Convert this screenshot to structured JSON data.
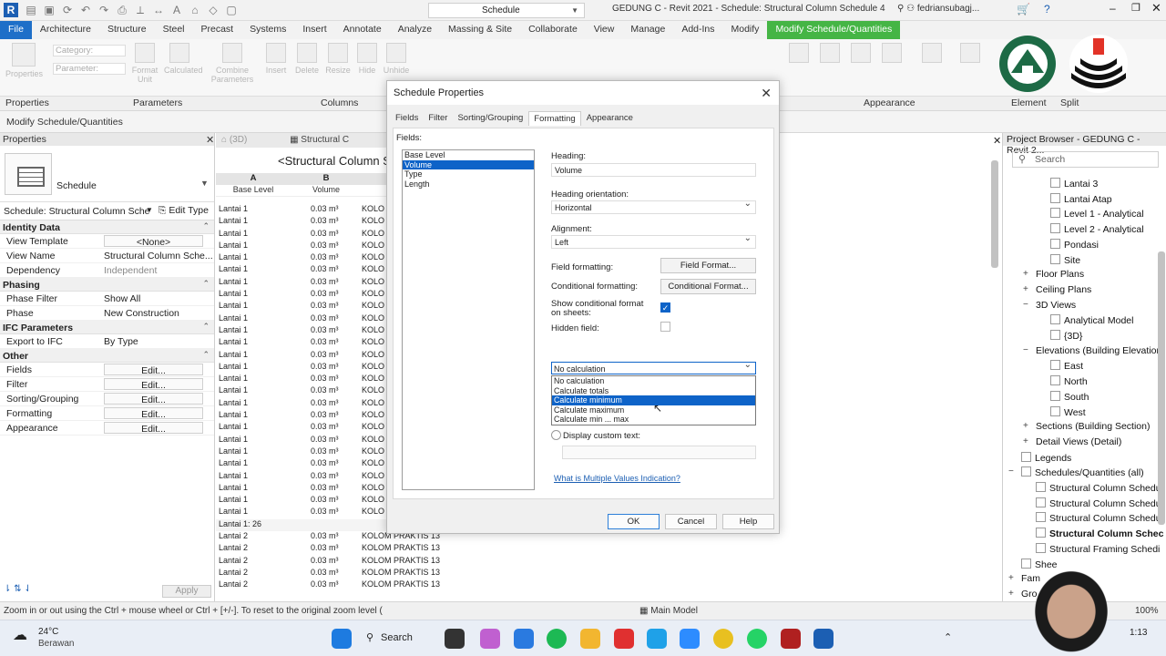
{
  "app": {
    "view_selector": "Schedule",
    "window_title": "GEDUNG C - Revit 2021 - Schedule: Structural Column Schedule 4",
    "user": "fedriansubagj...",
    "tabs": [
      "File",
      "Architecture",
      "Structure",
      "Steel",
      "Precast",
      "Systems",
      "Insert",
      "Annotate",
      "Analyze",
      "Massing & Site",
      "Collaborate",
      "View",
      "Manage",
      "Add-Ins",
      "Modify",
      "Modify Schedule/Quantities"
    ],
    "ribbon_groups": [
      "Properties",
      "Parameters",
      "Columns",
      "Appearance",
      "Element",
      "Split"
    ],
    "ribbon_tools": {
      "properties": "Properties",
      "category": "Category:",
      "parameter": "Parameter:",
      "format_unit": "Format\nUnit",
      "calculated": "Calculated",
      "combine_parameters": "Combine\nParameters",
      "insert": "Insert",
      "delete": "Delete",
      "resize": "Resize",
      "hide": "Hide",
      "unhide": "Unhide"
    },
    "context_bar": "Modify Schedule/Quantities"
  },
  "properties": {
    "title": "Properties",
    "type_name": "Schedule",
    "selector": "Schedule: Structural Column Sche",
    "edit_type": "Edit Type",
    "sections": [
      {
        "name": "Identity Data",
        "rows": [
          {
            "k": "View Template",
            "v": "<None>",
            "btn": true
          },
          {
            "k": "View Name",
            "v": "Structural Column Sche..."
          },
          {
            "k": "Dependency",
            "v": "Independent",
            "grey": true
          }
        ]
      },
      {
        "name": "Phasing",
        "rows": [
          {
            "k": "Phase Filter",
            "v": "Show All"
          },
          {
            "k": "Phase",
            "v": "New Construction"
          }
        ]
      },
      {
        "name": "IFC Parameters",
        "rows": [
          {
            "k": "Export to IFC",
            "v": "By Type"
          }
        ]
      },
      {
        "name": "Other",
        "rows": [
          {
            "k": "Fields",
            "v": "Edit...",
            "btn": true
          },
          {
            "k": "Filter",
            "v": "Edit...",
            "btn": true
          },
          {
            "k": "Sorting/Grouping",
            "v": "Edit...",
            "btn": true
          },
          {
            "k": "Formatting",
            "v": "Edit...",
            "btn": true
          },
          {
            "k": "Appearance",
            "v": "Edit...",
            "btn": true
          }
        ]
      }
    ],
    "apply": "Apply"
  },
  "schedule": {
    "tab_3d": "(3D)",
    "tab_sched": "Structural C",
    "title": "<Structural Column S",
    "col_letters": [
      "A",
      "B"
    ],
    "col_names": [
      "Base Level",
      "Volume"
    ],
    "rows_lantai1": {
      "level": "Lantai 1",
      "volume": "0.03 m³",
      "mark": "KOLO"
    },
    "lantai1_count": 26,
    "group_footer": "Lantai 1: 26",
    "rows_lantai2": {
      "level": "Lantai 2",
      "volume": "0.03 m³",
      "mark": "KOLOM PRAKTIS 13"
    }
  },
  "dialog": {
    "title": "Schedule Properties",
    "tabs": [
      "Fields",
      "Filter",
      "Sorting/Grouping",
      "Formatting",
      "Appearance"
    ],
    "active_tab": "Formatting",
    "fields_label": "Fields:",
    "fields": [
      "Base Level",
      "Volume",
      "Type",
      "Length"
    ],
    "selected_field": "Volume",
    "heading_label": "Heading:",
    "heading_value": "Volume",
    "orientation_label": "Heading orientation:",
    "orientation_value": "Horizontal",
    "alignment_label": "Alignment:",
    "alignment_value": "Left",
    "field_formatting_label": "Field formatting:",
    "field_format_button": "Field Format...",
    "conditional_label": "Conditional formatting:",
    "conditional_button": "Conditional Format...",
    "show_cond_label": "Show conditional format on sheets:",
    "hidden_field_label": "Hidden field:",
    "calc_value": "No calculation",
    "calc_options": [
      "No calculation",
      "Calculate totals",
      "Calculate minimum",
      "Calculate maximum",
      "Calculate min ... max"
    ],
    "calc_highlight": "Calculate minimum",
    "custom_text_label": "Display custom text:",
    "mvi_link": "What is Multiple Values Indication?",
    "ok": "OK",
    "cancel": "Cancel",
    "help": "Help"
  },
  "project_browser": {
    "title": "Project Browser - GEDUNG C - Revit 2...",
    "search_placeholder": "Search",
    "items": [
      {
        "t": "Lantai 3",
        "lvl": 2,
        "icon": true
      },
      {
        "t": "Lantai Atap",
        "lvl": 2,
        "icon": true
      },
      {
        "t": "Level 1 - Analytical",
        "lvl": 2,
        "icon": true
      },
      {
        "t": "Level 2 - Analytical",
        "lvl": 2,
        "icon": true
      },
      {
        "t": "Pondasi",
        "lvl": 2,
        "icon": true
      },
      {
        "t": "Site",
        "lvl": 2,
        "icon": true
      },
      {
        "t": "Floor Plans",
        "lvl": 1,
        "pm": "+"
      },
      {
        "t": "Ceiling Plans",
        "lvl": 1,
        "pm": "+"
      },
      {
        "t": "3D Views",
        "lvl": 1,
        "pm": "−"
      },
      {
        "t": "Analytical Model",
        "lvl": 2,
        "icon": true
      },
      {
        "t": "{3D}",
        "lvl": 2,
        "icon": true
      },
      {
        "t": "Elevations (Building Elevation)",
        "lvl": 1,
        "pm": "−"
      },
      {
        "t": "East",
        "lvl": 2,
        "icon": true
      },
      {
        "t": "North",
        "lvl": 2,
        "icon": true
      },
      {
        "t": "South",
        "lvl": 2,
        "icon": true
      },
      {
        "t": "West",
        "lvl": 2,
        "icon": true
      },
      {
        "t": "Sections (Building Section)",
        "lvl": 1,
        "pm": "+"
      },
      {
        "t": "Detail Views (Detail)",
        "lvl": 1,
        "pm": "+"
      },
      {
        "t": "Legends",
        "lvl": 0,
        "icon": true
      },
      {
        "t": "Schedules/Quantities (all)",
        "lvl": 0,
        "pm": "−",
        "icon": true
      },
      {
        "t": "Structural Column Schedu",
        "lvl": 1,
        "icon": true
      },
      {
        "t": "Structural Column Schedu",
        "lvl": 1,
        "icon": true
      },
      {
        "t": "Structural Column Schedu",
        "lvl": 1,
        "icon": true
      },
      {
        "t": "Structural Column Schec",
        "lvl": 1,
        "icon": true,
        "bold": true
      },
      {
        "t": "Structural Framing Schedi",
        "lvl": 1,
        "icon": true
      },
      {
        "t": "Shee",
        "lvl": 0,
        "icon": true
      },
      {
        "t": "Fam",
        "lvl": 0,
        "pm": "+"
      },
      {
        "t": "Gro",
        "lvl": 0,
        "pm": "+"
      }
    ]
  },
  "status": {
    "hint": "Zoom in or out using the Ctrl + mouse wheel or Ctrl + [+/-]. To reset to the original zoom level (",
    "model": "Main Model",
    "zoom": "100%"
  },
  "taskbar": {
    "temp": "24°C",
    "weather": "Berawan",
    "search": "Search",
    "time": "1:13"
  }
}
